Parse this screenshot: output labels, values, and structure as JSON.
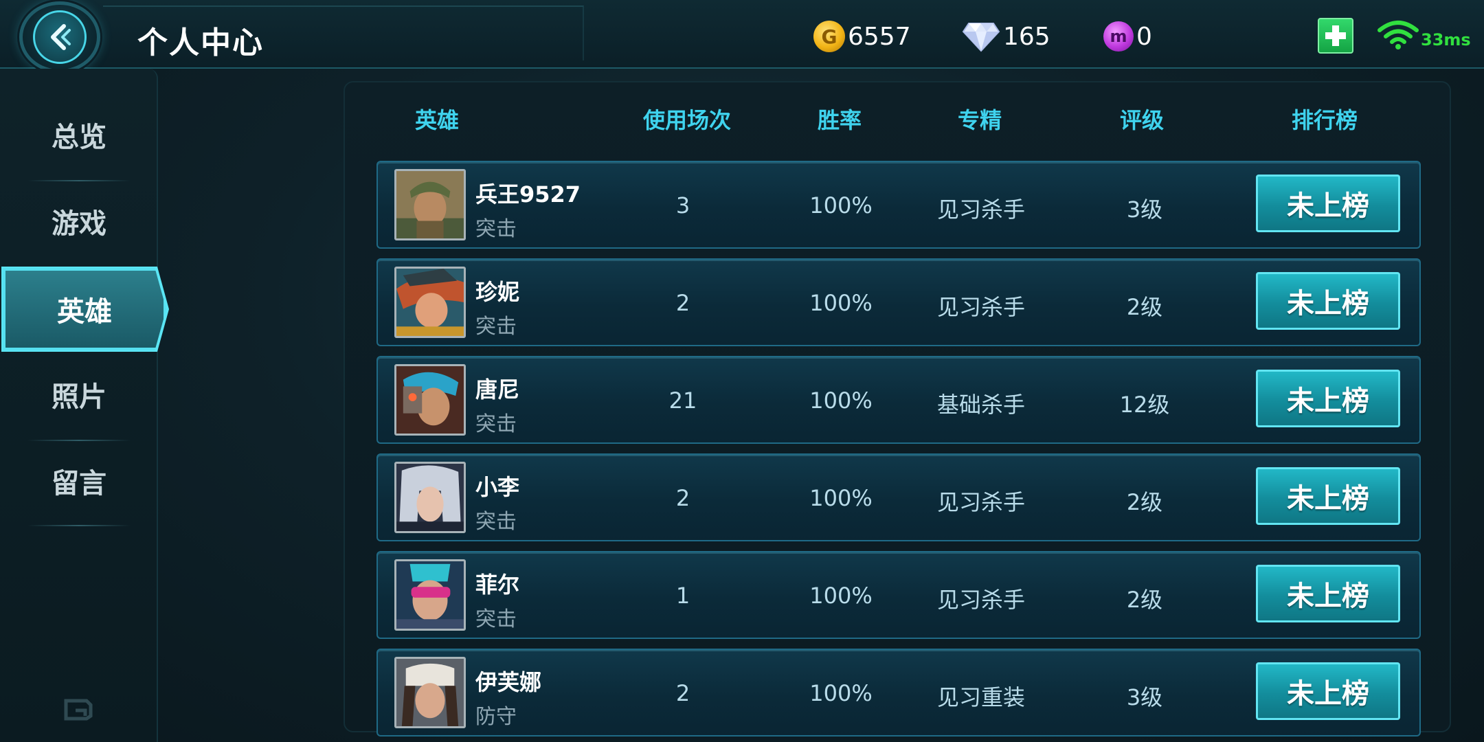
{
  "header": {
    "title": "个人中心",
    "back_icon": "back-arrow-icon",
    "currencies": [
      {
        "name": "gold",
        "icon": "gold-coin-icon",
        "value": "6557",
        "color": "#f2b416"
      },
      {
        "name": "diamond",
        "icon": "diamond-icon",
        "value": "165",
        "color": "#e8eefc"
      },
      {
        "name": "m-coin",
        "icon": "m-coin-icon",
        "value": "0",
        "color": "#c03adf"
      }
    ],
    "add_icon": "plus-icon",
    "wifi_icon": "wifi-icon",
    "ping": "33ms"
  },
  "sidebar": {
    "items": [
      {
        "label": "总览",
        "active": false
      },
      {
        "label": "游戏",
        "active": false
      },
      {
        "label": "英雄",
        "active": true
      },
      {
        "label": "照片",
        "active": false
      },
      {
        "label": "留言",
        "active": false
      }
    ],
    "footer_icon": "swap-icon"
  },
  "table": {
    "columns": [
      "英雄",
      "使用场次",
      "胜率",
      "专精",
      "评级",
      "排行榜"
    ],
    "rows": [
      {
        "name": "兵王9527",
        "role": "突击",
        "games": "3",
        "win_rate": "100%",
        "mastery": "见习杀手",
        "rating": "3级",
        "rank": "未上榜"
      },
      {
        "name": "珍妮",
        "role": "突击",
        "games": "2",
        "win_rate": "100%",
        "mastery": "见习杀手",
        "rating": "2级",
        "rank": "未上榜"
      },
      {
        "name": "唐尼",
        "role": "突击",
        "games": "21",
        "win_rate": "100%",
        "mastery": "基础杀手",
        "rating": "12级",
        "rank": "未上榜"
      },
      {
        "name": "小李",
        "role": "突击",
        "games": "2",
        "win_rate": "100%",
        "mastery": "见习杀手",
        "rating": "2级",
        "rank": "未上榜"
      },
      {
        "name": "菲尔",
        "role": "突击",
        "games": "1",
        "win_rate": "100%",
        "mastery": "见习杀手",
        "rating": "2级",
        "rank": "未上榜"
      },
      {
        "name": "伊芙娜",
        "role": "防守",
        "games": "2",
        "win_rate": "100%",
        "mastery": "见习重装",
        "rating": "3级",
        "rank": "未上榜"
      }
    ]
  },
  "colors": {
    "accent": "#3fd3ee",
    "button": "#1a9fae",
    "ping_green": "#31e03f"
  }
}
